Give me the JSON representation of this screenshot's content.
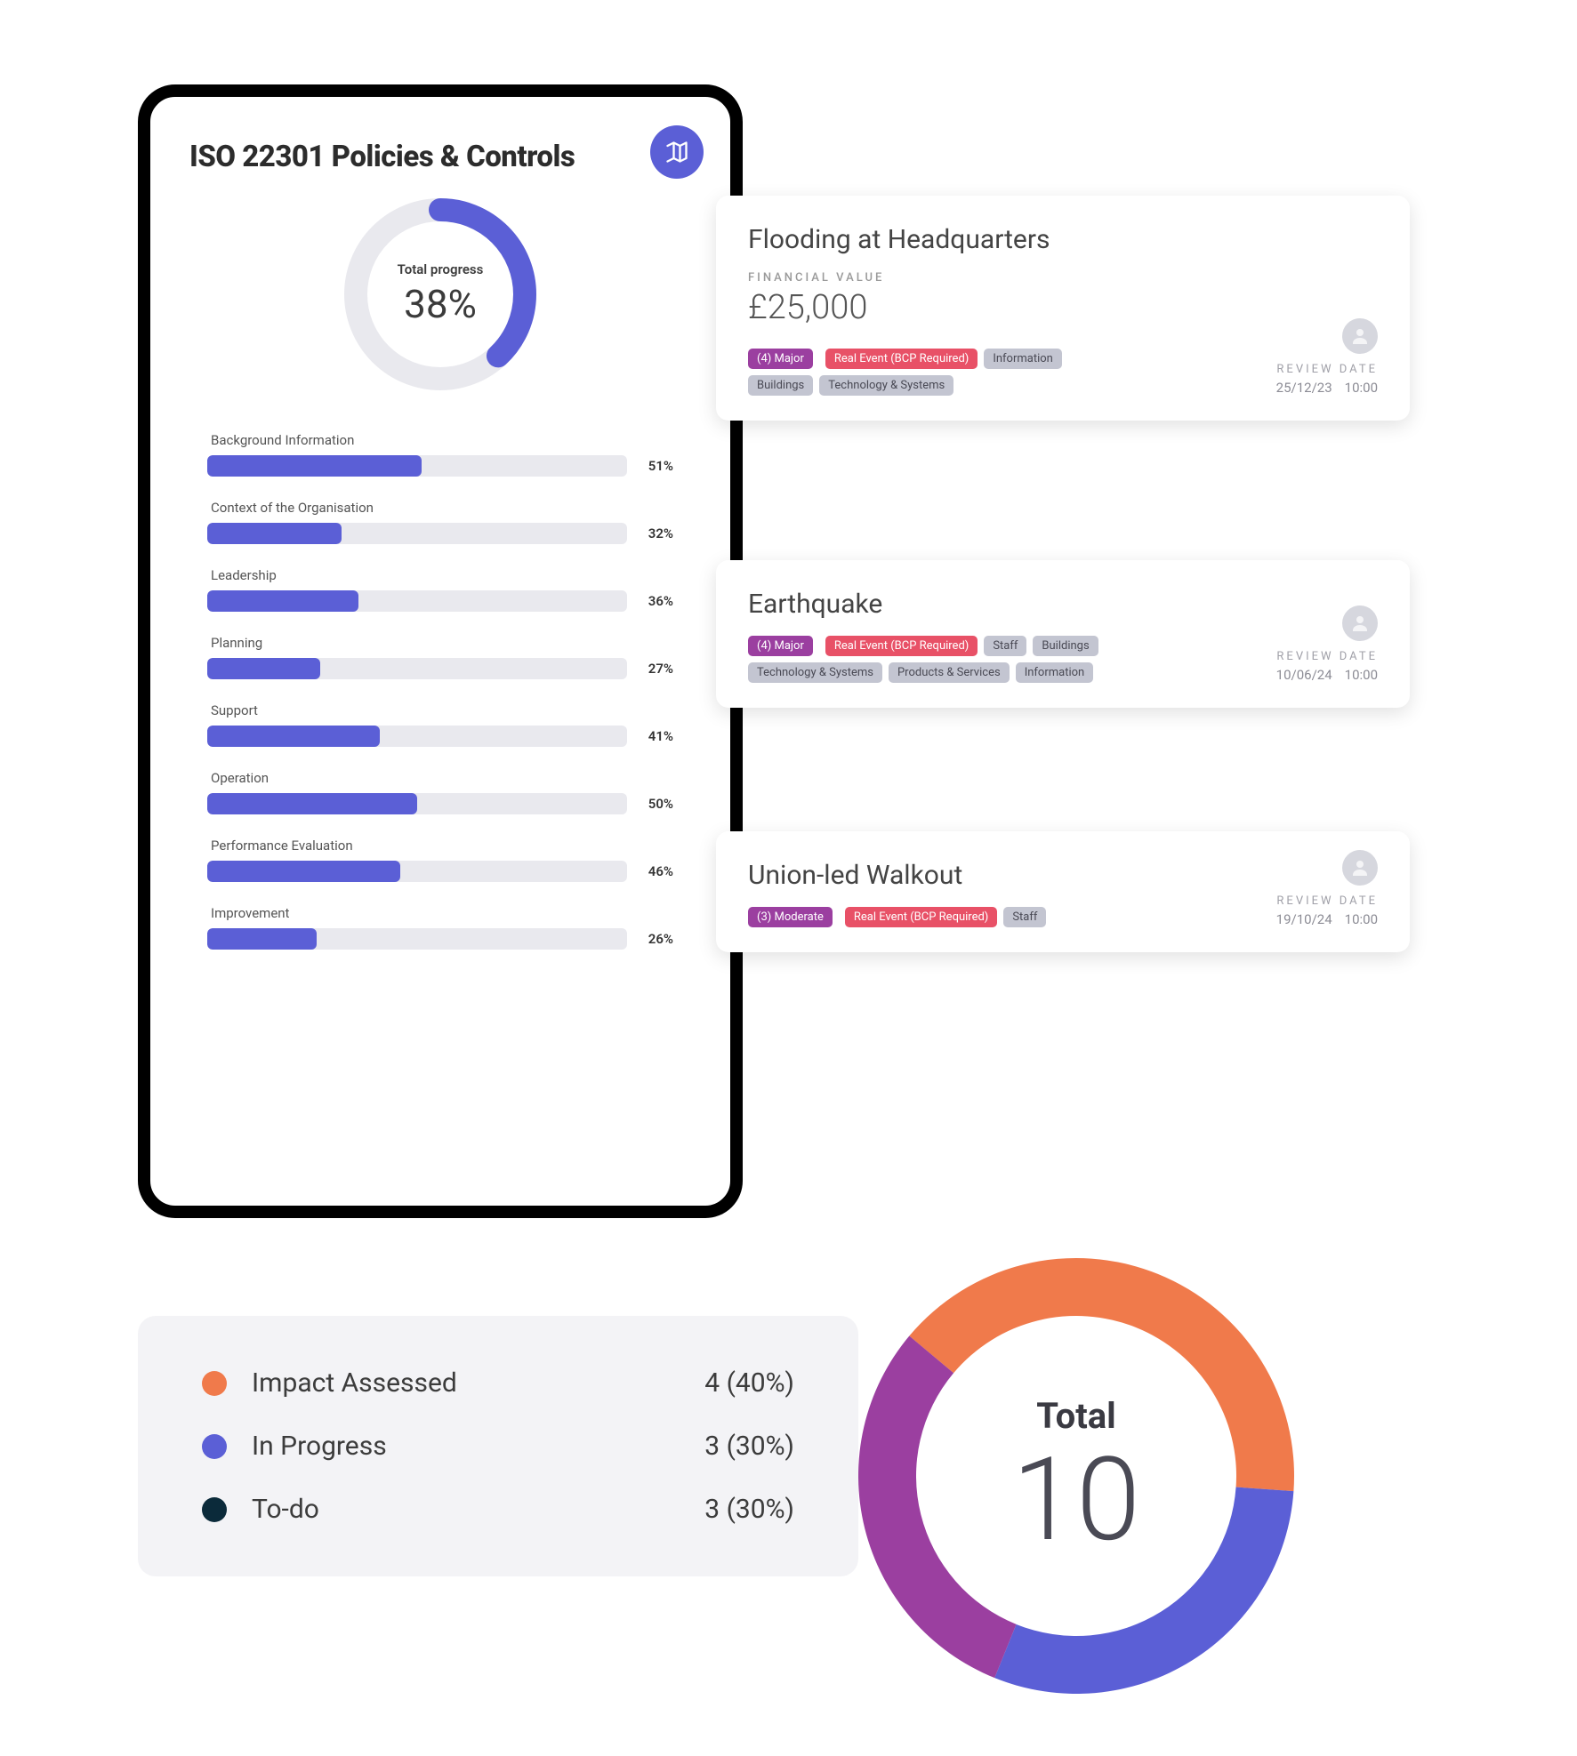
{
  "panel": {
    "title": "ISO 22301 Policies & Controls",
    "progress_label": "Total progress",
    "progress_pct_text": "38%",
    "progress_pct": 38,
    "icon": "map-icon",
    "bars": [
      {
        "label": "Background Information",
        "pct": 51,
        "pct_text": "51%"
      },
      {
        "label": "Context of the Organisation",
        "pct": 32,
        "pct_text": "32%"
      },
      {
        "label": "Leadership",
        "pct": 36,
        "pct_text": "36%"
      },
      {
        "label": "Planning",
        "pct": 27,
        "pct_text": "27%"
      },
      {
        "label": "Support",
        "pct": 41,
        "pct_text": "41%"
      },
      {
        "label": "Operation",
        "pct": 50,
        "pct_text": "50%"
      },
      {
        "label": "Performance Evaluation",
        "pct": 46,
        "pct_text": "46%"
      },
      {
        "label": "Improvement",
        "pct": 26,
        "pct_text": "26%"
      }
    ]
  },
  "incidents": [
    {
      "title": "Flooding at Headquarters",
      "financial_label": "FINANCIAL VALUE",
      "financial_value": "£25,000",
      "severity": {
        "text": "(4) Major",
        "color": "purple"
      },
      "event_type": {
        "text": "Real Event (BCP Required)",
        "color": "red"
      },
      "categories": [
        "Information",
        "Buildings",
        "Technology & Systems"
      ],
      "review_label": "REVIEW DATE",
      "review_date": "25/12/23",
      "review_time": "10:00"
    },
    {
      "title": "Earthquake",
      "severity": {
        "text": "(4) Major",
        "color": "purple"
      },
      "event_type": {
        "text": "Real Event (BCP Required)",
        "color": "red"
      },
      "categories": [
        "Staff",
        "Buildings",
        "Technology & Systems",
        "Products & Services",
        "Information"
      ],
      "review_label": "REVIEW DATE",
      "review_date": "10/06/24",
      "review_time": "10:00"
    },
    {
      "title": "Union-led Walkout",
      "severity": {
        "text": "(3) Moderate",
        "color": "purple"
      },
      "event_type": {
        "text": "Real Event (BCP Required)",
        "color": "red"
      },
      "categories": [
        "Staff"
      ],
      "review_label": "REVIEW DATE",
      "review_date": "19/10/24",
      "review_time": "10:00"
    }
  ],
  "legend": {
    "items": [
      {
        "label": "Impact Assessed",
        "value": "4 (40%)",
        "color": "#f07a4b"
      },
      {
        "label": "In Progress",
        "value": "3 (30%)",
        "color": "#5b5fd6"
      },
      {
        "label": "To-do",
        "value": "3 (30%)",
        "color": "#0b2a3a"
      }
    ]
  },
  "chart_data": {
    "type": "pie",
    "title": "Total",
    "total": "10",
    "series": [
      {
        "name": "Impact Assessed",
        "value": 4,
        "pct": 40,
        "color": "#f07a4b"
      },
      {
        "name": "In Progress",
        "value": 3,
        "pct": 30,
        "color": "#5b5fd6"
      },
      {
        "name": "To-do",
        "value": 3,
        "pct": 30,
        "color": "#9b3fa0"
      }
    ]
  }
}
